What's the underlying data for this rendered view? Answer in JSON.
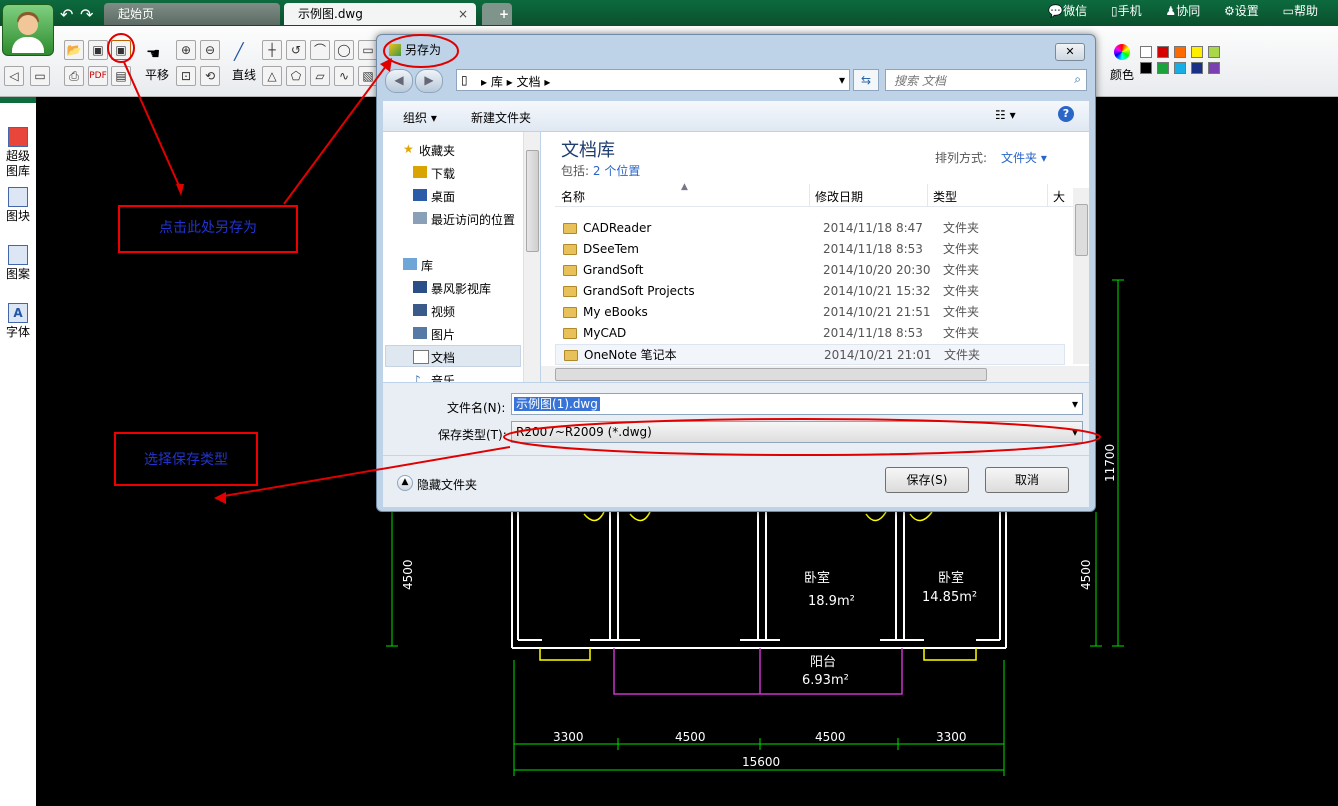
{
  "app": {
    "tabs": {
      "start": "起始页",
      "file": "示例图.dwg",
      "add": "+"
    },
    "top_links": [
      "微信",
      "手机",
      "协同",
      "设置",
      "帮助"
    ],
    "toolbar": {
      "pan_label": "平移",
      "line_label": "直线",
      "color_label": "颜色"
    },
    "palette": [
      "#ffffff",
      "#d40000",
      "#ff6a00",
      "#ffee00",
      "#a8d848",
      "#000000",
      "#1aa33a",
      "#17aee6",
      "#1a2f86",
      "#7a3fb0"
    ],
    "sidebar": [
      "超级图库",
      "图块",
      "图案",
      "字体"
    ]
  },
  "dialog": {
    "title": "另存为",
    "address": {
      "parts": [
        "库",
        "文档"
      ]
    },
    "search_placeholder": "搜索 文档",
    "cmd": {
      "organize": "组织 ▾",
      "new_folder": "新建文件夹"
    },
    "nav": {
      "favorites": "收藏夹",
      "favorites_items": [
        "下载",
        "桌面",
        "最近访问的位置"
      ],
      "library": "库",
      "library_items": [
        "暴风影视库",
        "视频",
        "图片",
        "文档",
        "音乐"
      ]
    },
    "library_title": "文档库",
    "library_sub": "包括:",
    "library_loc": "2 个位置",
    "sort_label": "排列方式:",
    "sort_value": "文件夹 ▾",
    "columns": {
      "name": "名称",
      "date": "修改日期",
      "type": "类型",
      "size": "大"
    },
    "files": [
      {
        "name": "CADReader",
        "date": "2014/11/18 8:47",
        "type": "文件夹"
      },
      {
        "name": "DSeeTem",
        "date": "2014/11/18 8:53",
        "type": "文件夹"
      },
      {
        "name": "GrandSoft",
        "date": "2014/10/20 20:30",
        "type": "文件夹"
      },
      {
        "name": "GrandSoft Projects",
        "date": "2014/10/21 15:32",
        "type": "文件夹"
      },
      {
        "name": "My eBooks",
        "date": "2014/10/21 21:51",
        "type": "文件夹"
      },
      {
        "name": "MyCAD",
        "date": "2014/11/18 8:53",
        "type": "文件夹"
      },
      {
        "name": "OneNote 笔记本",
        "date": "2014/10/21 21:01",
        "type": "文件夹"
      }
    ],
    "filename_label": "文件名(N):",
    "filename_value": "示例图(1).dwg",
    "filetype_label": "保存类型(T):",
    "filetype_value": "R2007~R2009 (*.dwg)",
    "hide_folders": "隐藏文件夹",
    "save_button": "保存(S)",
    "cancel_button": "取消"
  },
  "annotations": {
    "save_as": "点击此处另存为",
    "choose_type": "选择保存类型"
  },
  "drawing": {
    "rooms": [
      {
        "name": "卧室",
        "area": "18.9m²"
      },
      {
        "name": "卧室",
        "area": "14.85m²"
      },
      {
        "name": "阳台",
        "area": "6.93m²"
      }
    ],
    "dims_bottom": [
      "3300",
      "4500",
      "4500",
      "3300"
    ],
    "dim_total": "15600",
    "dim_left": "4500",
    "dim_right": "4500",
    "dim_right_outer": "11700"
  },
  "colors": {
    "accent_green": "#0d6b3e",
    "cad_line": "#00e000",
    "annotation_red": "#e00000",
    "annotation_text": "#2233cc"
  }
}
